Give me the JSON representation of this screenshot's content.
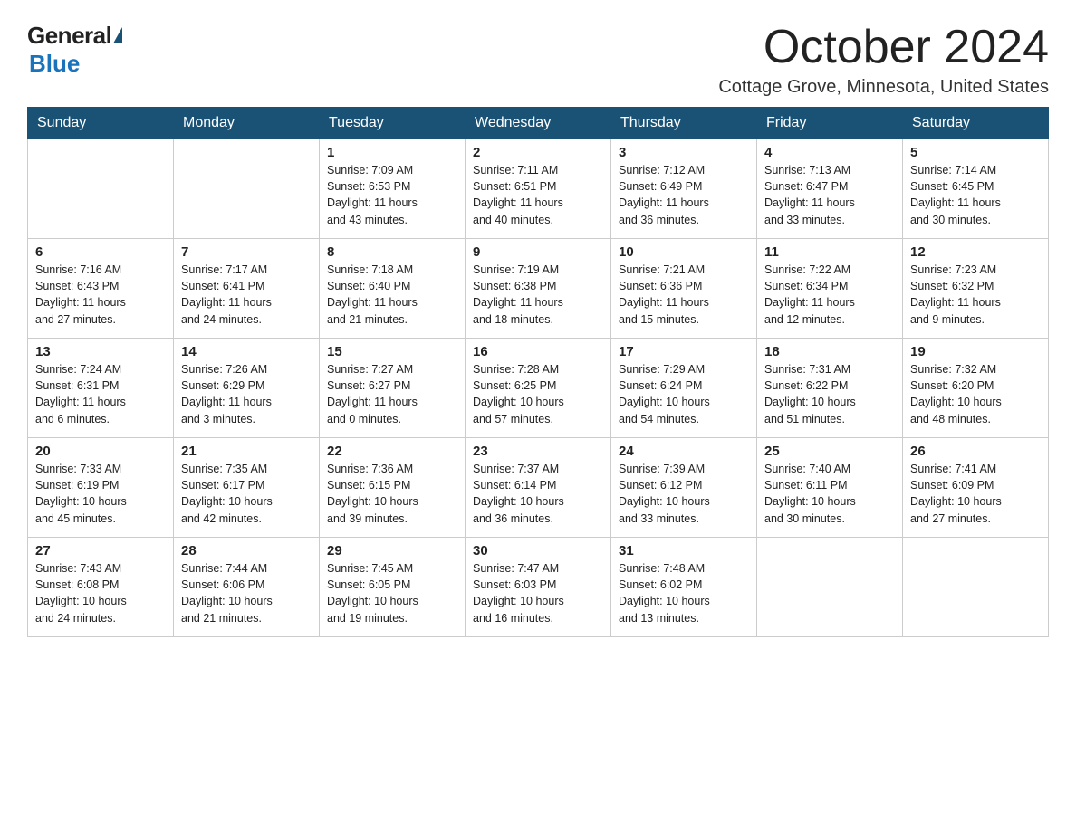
{
  "logo": {
    "general": "General",
    "blue": "Blue"
  },
  "title": "October 2024",
  "subtitle": "Cottage Grove, Minnesota, United States",
  "weekdays": [
    "Sunday",
    "Monday",
    "Tuesday",
    "Wednesday",
    "Thursday",
    "Friday",
    "Saturday"
  ],
  "weeks": [
    [
      {
        "day": "",
        "info": ""
      },
      {
        "day": "",
        "info": ""
      },
      {
        "day": "1",
        "info": "Sunrise: 7:09 AM\nSunset: 6:53 PM\nDaylight: 11 hours\nand 43 minutes."
      },
      {
        "day": "2",
        "info": "Sunrise: 7:11 AM\nSunset: 6:51 PM\nDaylight: 11 hours\nand 40 minutes."
      },
      {
        "day": "3",
        "info": "Sunrise: 7:12 AM\nSunset: 6:49 PM\nDaylight: 11 hours\nand 36 minutes."
      },
      {
        "day": "4",
        "info": "Sunrise: 7:13 AM\nSunset: 6:47 PM\nDaylight: 11 hours\nand 33 minutes."
      },
      {
        "day": "5",
        "info": "Sunrise: 7:14 AM\nSunset: 6:45 PM\nDaylight: 11 hours\nand 30 minutes."
      }
    ],
    [
      {
        "day": "6",
        "info": "Sunrise: 7:16 AM\nSunset: 6:43 PM\nDaylight: 11 hours\nand 27 minutes."
      },
      {
        "day": "7",
        "info": "Sunrise: 7:17 AM\nSunset: 6:41 PM\nDaylight: 11 hours\nand 24 minutes."
      },
      {
        "day": "8",
        "info": "Sunrise: 7:18 AM\nSunset: 6:40 PM\nDaylight: 11 hours\nand 21 minutes."
      },
      {
        "day": "9",
        "info": "Sunrise: 7:19 AM\nSunset: 6:38 PM\nDaylight: 11 hours\nand 18 minutes."
      },
      {
        "day": "10",
        "info": "Sunrise: 7:21 AM\nSunset: 6:36 PM\nDaylight: 11 hours\nand 15 minutes."
      },
      {
        "day": "11",
        "info": "Sunrise: 7:22 AM\nSunset: 6:34 PM\nDaylight: 11 hours\nand 12 minutes."
      },
      {
        "day": "12",
        "info": "Sunrise: 7:23 AM\nSunset: 6:32 PM\nDaylight: 11 hours\nand 9 minutes."
      }
    ],
    [
      {
        "day": "13",
        "info": "Sunrise: 7:24 AM\nSunset: 6:31 PM\nDaylight: 11 hours\nand 6 minutes."
      },
      {
        "day": "14",
        "info": "Sunrise: 7:26 AM\nSunset: 6:29 PM\nDaylight: 11 hours\nand 3 minutes."
      },
      {
        "day": "15",
        "info": "Sunrise: 7:27 AM\nSunset: 6:27 PM\nDaylight: 11 hours\nand 0 minutes."
      },
      {
        "day": "16",
        "info": "Sunrise: 7:28 AM\nSunset: 6:25 PM\nDaylight: 10 hours\nand 57 minutes."
      },
      {
        "day": "17",
        "info": "Sunrise: 7:29 AM\nSunset: 6:24 PM\nDaylight: 10 hours\nand 54 minutes."
      },
      {
        "day": "18",
        "info": "Sunrise: 7:31 AM\nSunset: 6:22 PM\nDaylight: 10 hours\nand 51 minutes."
      },
      {
        "day": "19",
        "info": "Sunrise: 7:32 AM\nSunset: 6:20 PM\nDaylight: 10 hours\nand 48 minutes."
      }
    ],
    [
      {
        "day": "20",
        "info": "Sunrise: 7:33 AM\nSunset: 6:19 PM\nDaylight: 10 hours\nand 45 minutes."
      },
      {
        "day": "21",
        "info": "Sunrise: 7:35 AM\nSunset: 6:17 PM\nDaylight: 10 hours\nand 42 minutes."
      },
      {
        "day": "22",
        "info": "Sunrise: 7:36 AM\nSunset: 6:15 PM\nDaylight: 10 hours\nand 39 minutes."
      },
      {
        "day": "23",
        "info": "Sunrise: 7:37 AM\nSunset: 6:14 PM\nDaylight: 10 hours\nand 36 minutes."
      },
      {
        "day": "24",
        "info": "Sunrise: 7:39 AM\nSunset: 6:12 PM\nDaylight: 10 hours\nand 33 minutes."
      },
      {
        "day": "25",
        "info": "Sunrise: 7:40 AM\nSunset: 6:11 PM\nDaylight: 10 hours\nand 30 minutes."
      },
      {
        "day": "26",
        "info": "Sunrise: 7:41 AM\nSunset: 6:09 PM\nDaylight: 10 hours\nand 27 minutes."
      }
    ],
    [
      {
        "day": "27",
        "info": "Sunrise: 7:43 AM\nSunset: 6:08 PM\nDaylight: 10 hours\nand 24 minutes."
      },
      {
        "day": "28",
        "info": "Sunrise: 7:44 AM\nSunset: 6:06 PM\nDaylight: 10 hours\nand 21 minutes."
      },
      {
        "day": "29",
        "info": "Sunrise: 7:45 AM\nSunset: 6:05 PM\nDaylight: 10 hours\nand 19 minutes."
      },
      {
        "day": "30",
        "info": "Sunrise: 7:47 AM\nSunset: 6:03 PM\nDaylight: 10 hours\nand 16 minutes."
      },
      {
        "day": "31",
        "info": "Sunrise: 7:48 AM\nSunset: 6:02 PM\nDaylight: 10 hours\nand 13 minutes."
      },
      {
        "day": "",
        "info": ""
      },
      {
        "day": "",
        "info": ""
      }
    ]
  ]
}
